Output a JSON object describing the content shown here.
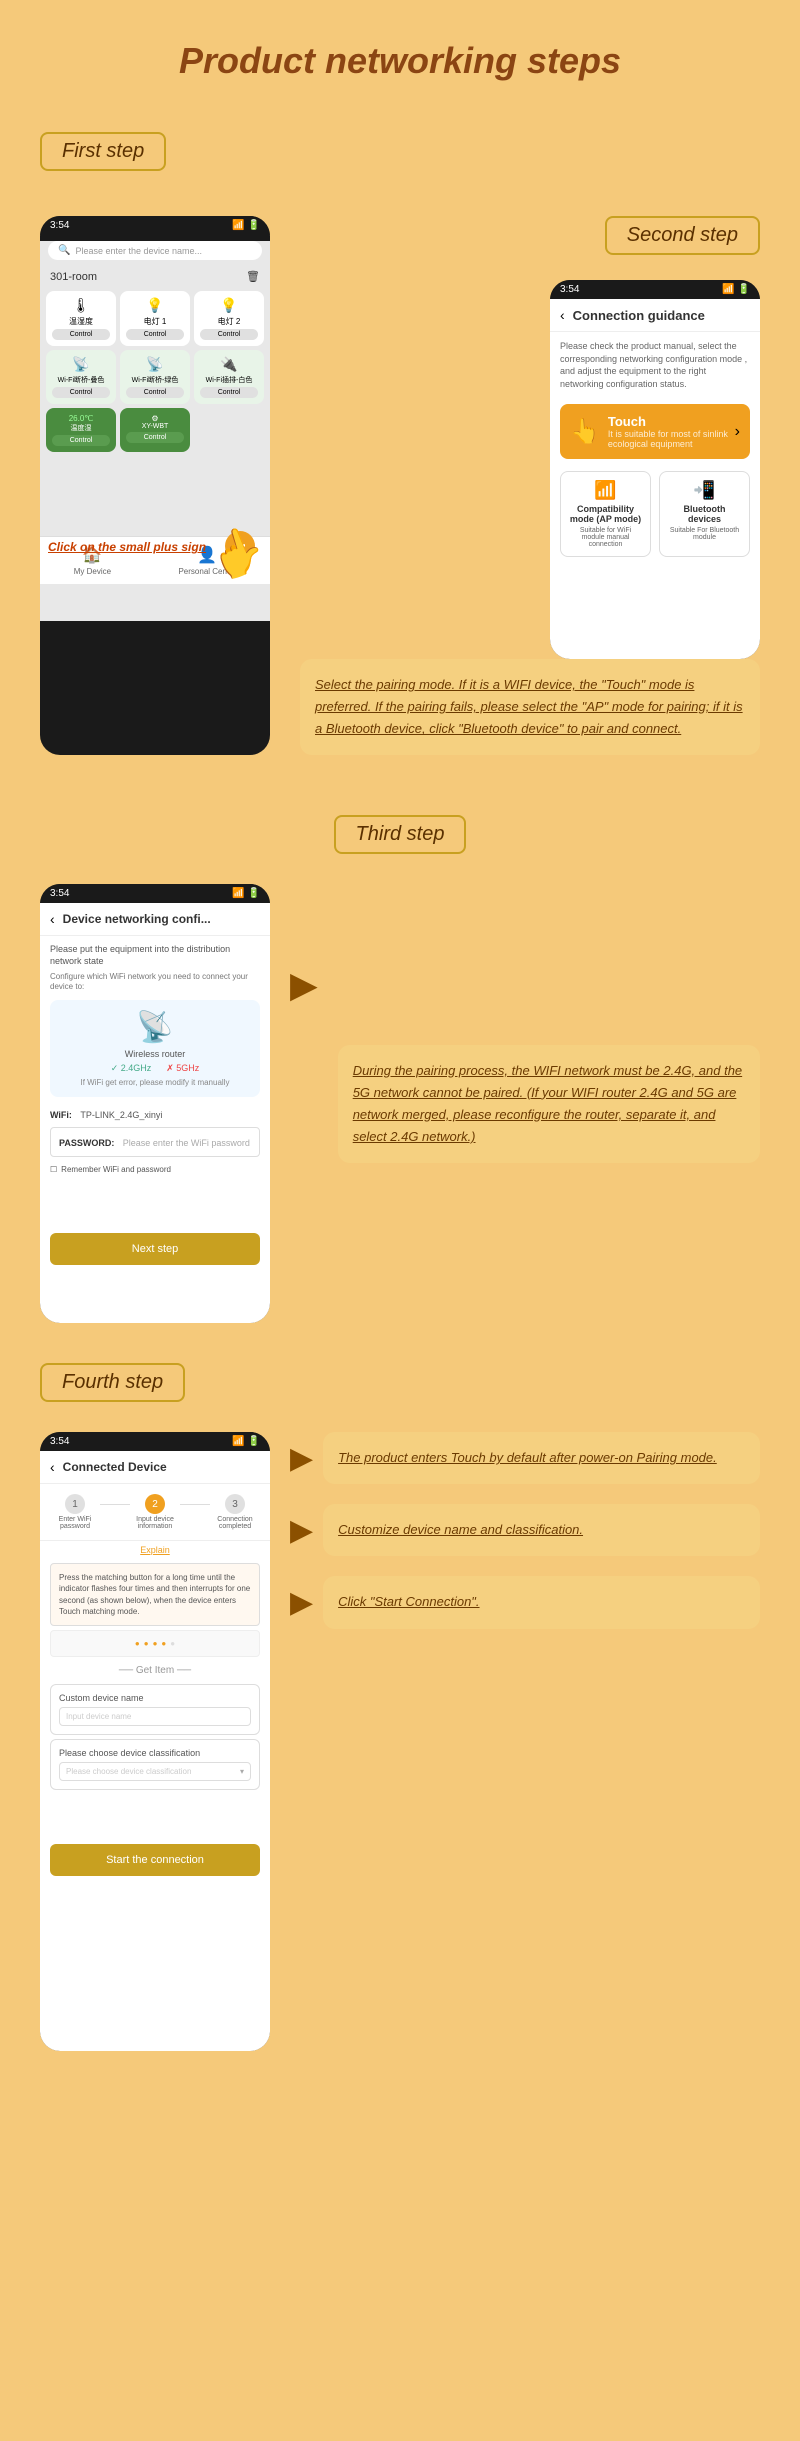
{
  "page": {
    "title": "Product networking steps",
    "bg_color": "#f5c97a"
  },
  "first_step": {
    "label": "First step",
    "click_annotation": "Click on the small plus sign",
    "phone": {
      "time": "3:54",
      "search_placeholder": "Please enter the device name...",
      "room": "301-room",
      "devices": [
        {
          "name": "温湿度",
          "ctrl": "Control"
        },
        {
          "name": "电灯 1",
          "ctrl": "Control"
        },
        {
          "name": "电灯 2",
          "ctrl": "Control"
        },
        {
          "name": "Wi-Fi断桥-叠色",
          "ctrl": "Control"
        },
        {
          "name": "Wi-Fi断桥-绿色",
          "ctrl": "Control"
        },
        {
          "name": "Wi-Fi插排-白色",
          "ctrl": "Control"
        },
        {
          "name": "26.0℃ 温度湿",
          "ctrl": "Control",
          "active": true
        },
        {
          "name": "XY-WBT",
          "ctrl": "Control",
          "active": true
        }
      ],
      "nav": [
        "My Device",
        "Personal Center"
      ]
    }
  },
  "second_step": {
    "label": "Second step",
    "phone": {
      "time": "3:54",
      "back": "〈",
      "title": "Connection guidance",
      "description": "Please check the product manual, select the corresponding networking configuration mode , and adjust the equipment to the right networking configuration status.",
      "touch_label": "Touch",
      "touch_sub": "It is suitable for most of sinlink ecological equipment",
      "ap_mode_title": "Compatibility mode (AP mode)",
      "ap_mode_desc": "Suitable for WiFi module manual connection",
      "bt_title": "Bluetooth devices",
      "bt_desc": "Suitable For Bluetooth module"
    },
    "note": "Select the pairing mode. If it is a WIFI device, the \"Touch\" mode is preferred. If the pairing fails, please select the \"AP\" mode for pairing; if it is a Bluetooth device, click \"Bluetooth device\" to pair and connect."
  },
  "third_step": {
    "label": "Third step",
    "phone": {
      "time": "3:54",
      "back": "〈",
      "title": "Device networking confi...",
      "desc1": "Please put the equipment into the distribution network state",
      "desc2": "Configure which WiFi network you need to connect your device to:",
      "router_label": "Wireless router",
      "wifi_24": "✓ 2.4GHz",
      "wifi_5g": "✗ 5GHz",
      "modify_note": "If WiFi get error, please modify it manually",
      "wifi_label": "WiFi:",
      "wifi_value": "TP-LINK_2.4G_xinyi",
      "pwd_label": "PASSWORD:",
      "pwd_placeholder": "Please enter the WiFi password",
      "remember": "Remember WiFi and password",
      "next_btn": "Next step"
    },
    "note": "During the pairing process, the WIFI network must be 2.4G, and the 5G network cannot be paired. (If your WIFI router 2.4G and 5G are network merged, please reconfigure the router, separate it, and select 2.4G network.)"
  },
  "fourth_step": {
    "label": "Fourth step",
    "phone": {
      "time": "3:54",
      "back": "〈",
      "title": "Connected Device",
      "steps": [
        {
          "num": "1",
          "label": "Enter WiFi password",
          "active": false
        },
        {
          "num": "2",
          "label": "Input device information",
          "active": true
        },
        {
          "num": "3",
          "label": "Connection completed",
          "active": false
        }
      ],
      "explain": "Explain",
      "pairing_note": "Press the matching button for a long time until the indicator flashes four times and then interrupts for one second (as shown below), when the device enters Touch matching mode.",
      "get_item_label": "Get Item",
      "custom_device_name": "Custom device name",
      "device_name_placeholder": "Input device name",
      "device_classify": "Please choose device classification",
      "classify_placeholder": "Please choose device classification",
      "start_btn": "Start the connection"
    },
    "notes": [
      "The product enters Touch by default after power-on Pairing mode.",
      "Customize device name and classification.",
      "Click \"Start Connection\"."
    ]
  }
}
